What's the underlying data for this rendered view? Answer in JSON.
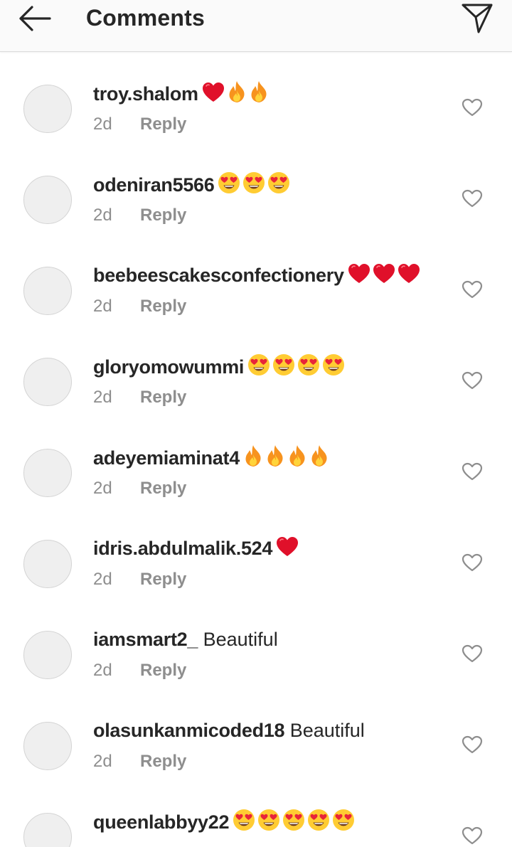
{
  "header": {
    "title": "Comments",
    "back_icon": "arrow-left-icon",
    "send_icon": "paper-plane-icon"
  },
  "colors": {
    "text": "#262626",
    "muted": "#8e8e8e",
    "header_bg": "#fafafa",
    "avatar_bg": "#efefef",
    "heart_red": "#e0102a",
    "fire_orange": "#f7931e"
  },
  "comments": [
    {
      "username": "troy.shalom",
      "text": "",
      "emojis": [
        "red-heart",
        "fire",
        "fire"
      ],
      "time": "2d",
      "reply": "Reply"
    },
    {
      "username": "odeniran5566",
      "text": "",
      "emojis": [
        "heart-eyes",
        "heart-eyes",
        "heart-eyes"
      ],
      "time": "2d",
      "reply": "Reply"
    },
    {
      "username": "beebeescakesconfectionery",
      "text": "",
      "emojis": [
        "red-heart",
        "red-heart",
        "red-heart"
      ],
      "time": "2d",
      "reply": "Reply"
    },
    {
      "username": "gloryomowummi",
      "text": "",
      "emojis": [
        "heart-eyes",
        "heart-eyes",
        "heart-eyes",
        "heart-eyes"
      ],
      "time": "2d",
      "reply": "Reply"
    },
    {
      "username": "adeyemiaminat4",
      "text": "",
      "emojis": [
        "fire",
        "fire",
        "fire",
        "fire"
      ],
      "time": "2d",
      "reply": "Reply"
    },
    {
      "username": "idris.abdulmalik.524",
      "text": "",
      "emojis": [
        "red-heart"
      ],
      "time": "2d",
      "reply": "Reply"
    },
    {
      "username": "iamsmart2_",
      "text": "Beautiful",
      "emojis": [],
      "time": "2d",
      "reply": "Reply"
    },
    {
      "username": "olasunkanmicoded18",
      "text": "Beautiful",
      "emojis": [],
      "time": "2d",
      "reply": "Reply"
    },
    {
      "username": "queenlabbyy22",
      "text": "",
      "emojis": [
        "heart-eyes",
        "heart-eyes",
        "heart-eyes",
        "heart-eyes",
        "heart-eyes"
      ],
      "time": "",
      "reply": ""
    }
  ]
}
